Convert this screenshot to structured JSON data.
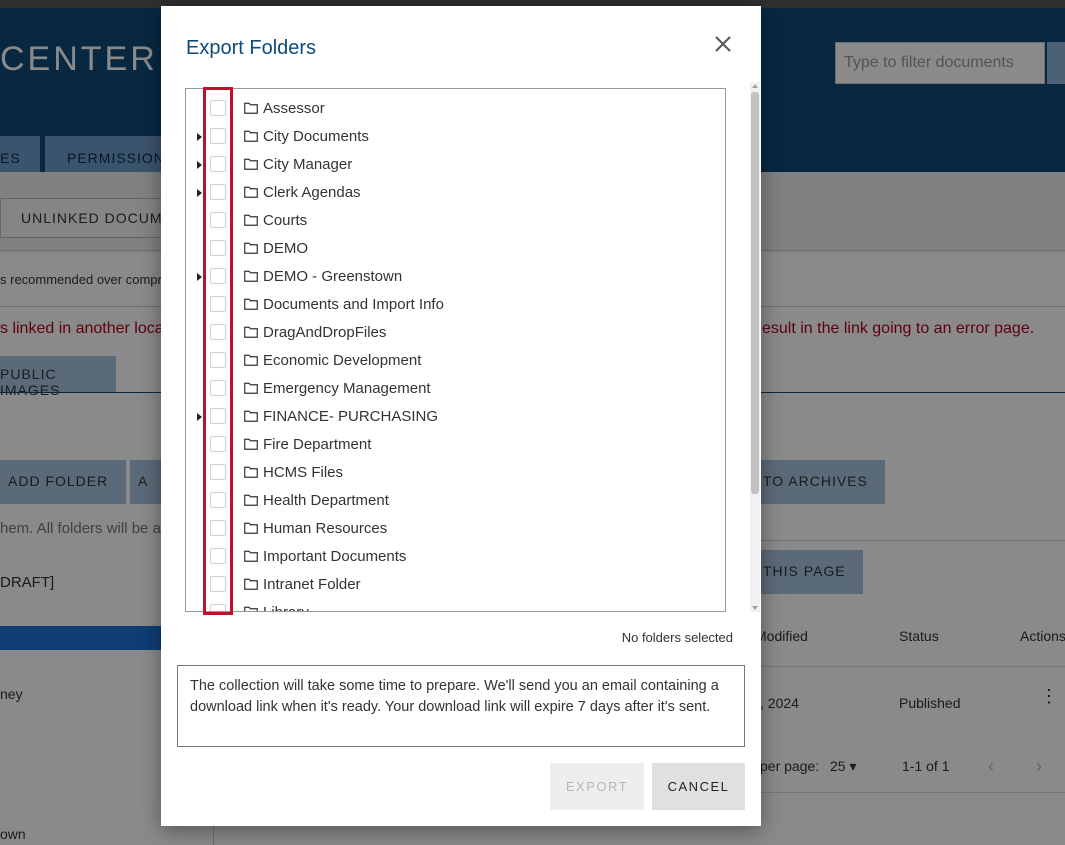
{
  "background": {
    "header_title": "CENTER",
    "filter_placeholder": "Type to filter documents",
    "tab_partial": "ES",
    "tab_permissions": "PERMISSIONS",
    "unlinked_button": "UNLINKED DOCUME",
    "recommended_text": "s recommended over compr",
    "warning_left": "s linked in another loca",
    "warning_right": "esult in the link going to an error page.",
    "public_images_tab": "PUBLIC IMAGES",
    "add_folder_button": "ADD FOLDER",
    "add_partial_button": "A",
    "to_archives_button": "TO ARCHIVES",
    "hint_text": "hem. All folders will be a",
    "draft_text": "DRAFT]",
    "this_page_button": "THIS PAGE",
    "col_modified": "Modified",
    "col_status": "Status",
    "col_actions": "Actions",
    "row_date": ", 2024",
    "row_status": "Published",
    "left_name": "ney",
    "per_page_label": "per page:",
    "per_page_value": "25",
    "page_range": "1-1 of 1",
    "left_town": "own"
  },
  "dialog": {
    "title": "Export Folders",
    "folders": [
      {
        "name": "Assessor",
        "expandable": false
      },
      {
        "name": "City Documents",
        "expandable": true
      },
      {
        "name": "City Manager",
        "expandable": true
      },
      {
        "name": "Clerk Agendas",
        "expandable": true
      },
      {
        "name": "Courts",
        "expandable": false
      },
      {
        "name": "DEMO",
        "expandable": false
      },
      {
        "name": "DEMO - Greenstown",
        "expandable": true
      },
      {
        "name": "Documents and Import Info",
        "expandable": false
      },
      {
        "name": "DragAndDropFiles",
        "expandable": false
      },
      {
        "name": "Economic Development",
        "expandable": false
      },
      {
        "name": "Emergency Management",
        "expandable": false
      },
      {
        "name": "FINANCE- PURCHASING",
        "expandable": true
      },
      {
        "name": "Fire Department",
        "expandable": false
      },
      {
        "name": "HCMS Files",
        "expandable": false
      },
      {
        "name": "Health Department",
        "expandable": false
      },
      {
        "name": "Human Resources",
        "expandable": false
      },
      {
        "name": "Important Documents",
        "expandable": false
      },
      {
        "name": "Intranet Folder",
        "expandable": false
      },
      {
        "name": "Library",
        "expandable": false
      }
    ],
    "selected_status": "No folders selected",
    "info_text": "The collection will take some time to prepare. We'll send you an email containing a download link when it's ready. Your download link will expire 7 days after it's sent.",
    "export_label": "EXPORT",
    "cancel_label": "CANCEL"
  },
  "colors": {
    "header_blue": "#0f4a7a",
    "highlight_red": "#c0112b",
    "title_blue": "#0f4a7a"
  }
}
